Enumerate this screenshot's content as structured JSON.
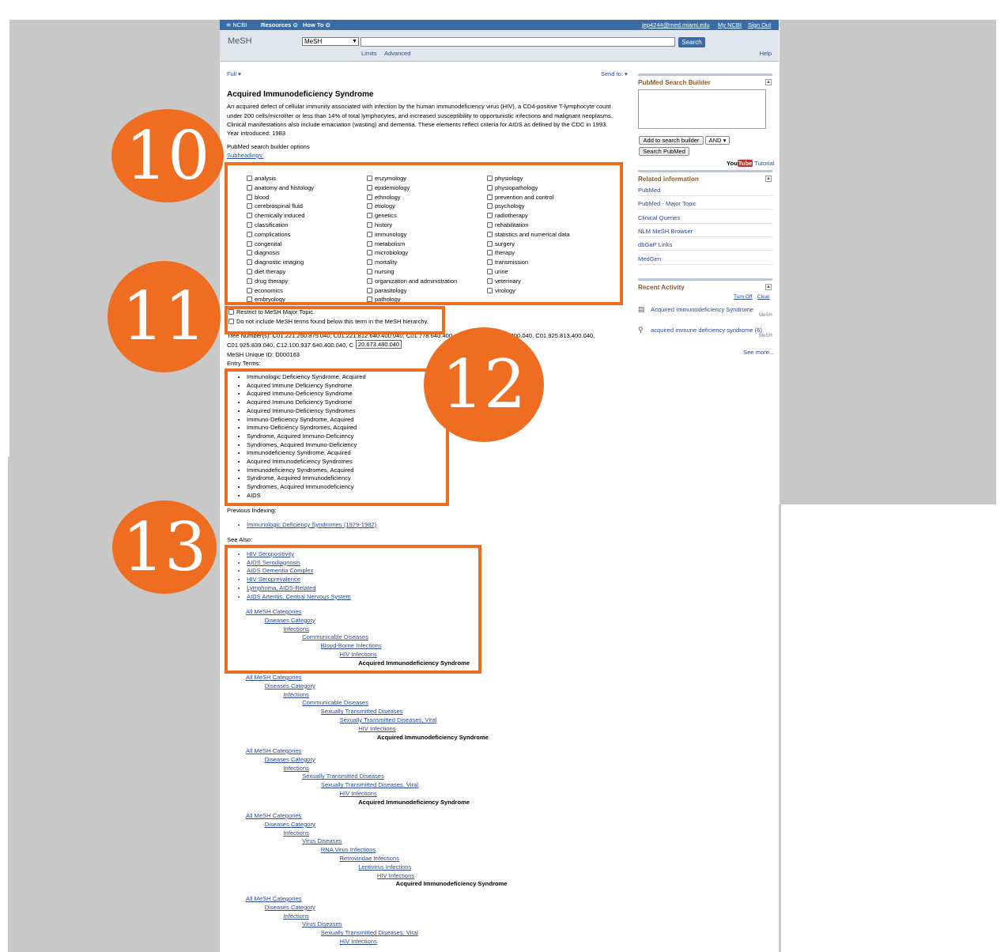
{
  "topbar": {
    "ncbi": "NCBI",
    "resources": "Resources",
    "howto": "How To",
    "user": "jep4244@med.miami.edu",
    "mync": "My NCBI",
    "signout": "Sign Out"
  },
  "search": {
    "db_label": "MeSH",
    "db_selected": "MeSH",
    "button": "Search",
    "limits": "Limits",
    "advanced": "Advanced",
    "help": "Help"
  },
  "toolbar": {
    "format": "Full",
    "sendto": "Send to:"
  },
  "record": {
    "title": "Acquired Immunodeficiency Syndrome",
    "description": "An acquired defect of cellular immunity associated with infection by the human immunodeficiency virus (HIV), a CD4-positive T-lymphocyte count under 200 cells/microliter or less than 14% of total lymphocytes, and increased susceptibility to opportunistic infections and malignant neoplasms. Clinical manifestations also include emaciation (wasting) and dementia. These elements reflect criteria for AIDS as defined by the CDC in 1993.",
    "year": "Year introduced: 1983",
    "builder_opts": "PubMed search builder options",
    "subheadings_label": "Subheadings:",
    "subheadings": [
      [
        "analysis",
        "anatomy and histology",
        "blood",
        "cerebrospinal fluid",
        "chemically induced",
        "classification",
        "complications",
        "congenital",
        "diagnosis",
        "diagnostic imaging",
        "diet therapy",
        "drug therapy",
        "economics",
        "embryology"
      ],
      [
        "enzymology",
        "epidemiology",
        "ethnology",
        "etiology",
        "genetics",
        "history",
        "immunology",
        "metabolism",
        "microbiology",
        "mortality",
        "nursing",
        "organization and administration",
        "parasitology",
        "pathology"
      ],
      [
        "physiology",
        "physiopathology",
        "prevention and control",
        "psychology",
        "radiotherapy",
        "rehabilitation",
        "statistics and numerical data",
        "surgery",
        "therapy",
        "transmission",
        "urine",
        "veterinary",
        "virology"
      ]
    ],
    "restrict_major": "Restrict to MeSH Major Topic.",
    "no_explode": "Do not include MeSH terms found below this term in the MeSH hierarchy.",
    "tree_line1": "Tree Number(s): C01.221.250.875.040, C01.221.812.640.400.040, C01.778.640.400",
    "tree_line1b": "815.616.400.040, C01.925.813.400.040,",
    "tree_line2": "C01.925.839.040, C12.100.937.640.400.040, C",
    "tooltip": "20.673.480.040",
    "unique_id": "MeSH Unique ID: D000163",
    "entry_terms_label": "Entry Terms:",
    "entry_terms": [
      "Immunologic Deficiency Syndrome, Acquired",
      "Acquired Immune Deficiency Syndrome",
      "Acquired Immuno-Deficiency Syndrome",
      "Acquired Immuno Deficiency Syndrome",
      "Acquired Immuno-Deficiency Syndromes",
      "Immuno-Deficiency Syndrome, Acquired",
      "Immuno-Deficiency Syndromes, Acquired",
      "Syndrome, Acquired Immuno-Deficiency",
      "Syndromes, Acquired Immuno-Deficiency",
      "Immunodeficiency Syndrome, Acquired",
      "Acquired Immunodeficiency Syndromes",
      "Immunodeficiency Syndromes, Acquired",
      "Syndrome, Acquired Immunodeficiency",
      "Syndromes, Acquired Immunodeficiency",
      "AIDS"
    ],
    "prev_indexing_label": "Previous Indexing:",
    "prev_indexing": [
      "Immunologic Deficiency Syndromes (1979-1982)"
    ],
    "see_also_label": "See Also:",
    "see_also": [
      "HIV Seropositivity",
      "AIDS Serodiagnosis",
      "AIDS Dementia Complex",
      "HIV Seroprevalence",
      "Lymphoma, AIDS-Related",
      "AIDS Arteritis, Central Nervous System"
    ],
    "trees": [
      [
        "All MeSH Categories",
        "Diseases Category",
        "Infections",
        "Communicable Diseases",
        "Blood-Borne Infections",
        "HIV Infections",
        "Acquired Immunodeficiency Syndrome"
      ],
      [
        "All MeSH Categories",
        "Diseases Category",
        "Infections",
        "Communicable Diseases",
        "Sexually Transmitted Diseases",
        "Sexually Transmitted Diseases, Viral",
        "HIV Infections",
        "Acquired Immunodeficiency Syndrome"
      ],
      [
        "All MeSH Categories",
        "Diseases Category",
        "Infections",
        "Sexually Transmitted Diseases",
        "Sexually Transmitted Diseases, Viral",
        "HIV Infections",
        "Acquired Immunodeficiency Syndrome"
      ],
      [
        "All MeSH Categories",
        "Diseases Category",
        "Infections",
        "Virus Diseases",
        "RNA Virus Infections",
        "Retroviridae Infections",
        "Lentivirus Infections",
        "HIV Infections",
        "Acquired Immunodeficiency Syndrome"
      ],
      [
        "All MeSH Categories",
        "Diseases Category",
        "Infections",
        "Virus Diseases",
        "Sexually Transmitted Diseases, Viral",
        "HIV Infections"
      ]
    ]
  },
  "sidebar": {
    "builder_title": "PubMed Search Builder",
    "add_btn": "Add to search builder",
    "op": "AND",
    "search_btn": "Search PubMed",
    "tutorial_you": "You",
    "tutorial_tube": "Tube",
    "tutorial": "Tutorial",
    "related_title": "Related information",
    "related": [
      "PubMed",
      "PubMed - Major Topic",
      "Clinical Queries",
      "NLM MeSH Browser",
      "dbGaP Links",
      "MedGen"
    ],
    "recent_title": "Recent Activity",
    "turnoff": "Turn Off",
    "clear": "Clear",
    "recent": [
      {
        "text": "Acquired Immunodeficiency Syndrome",
        "tag": "MeSH"
      },
      {
        "text": "acquired immune deficiency syndrome (6)",
        "tag": "MeSH"
      }
    ],
    "see_more": "See more..."
  },
  "badges": [
    "10",
    "11",
    "12",
    "13"
  ],
  "colors": {
    "accent": "#ef6d20",
    "ncbi_blue": "#3b6ba5",
    "link": "#2a4b9b"
  }
}
